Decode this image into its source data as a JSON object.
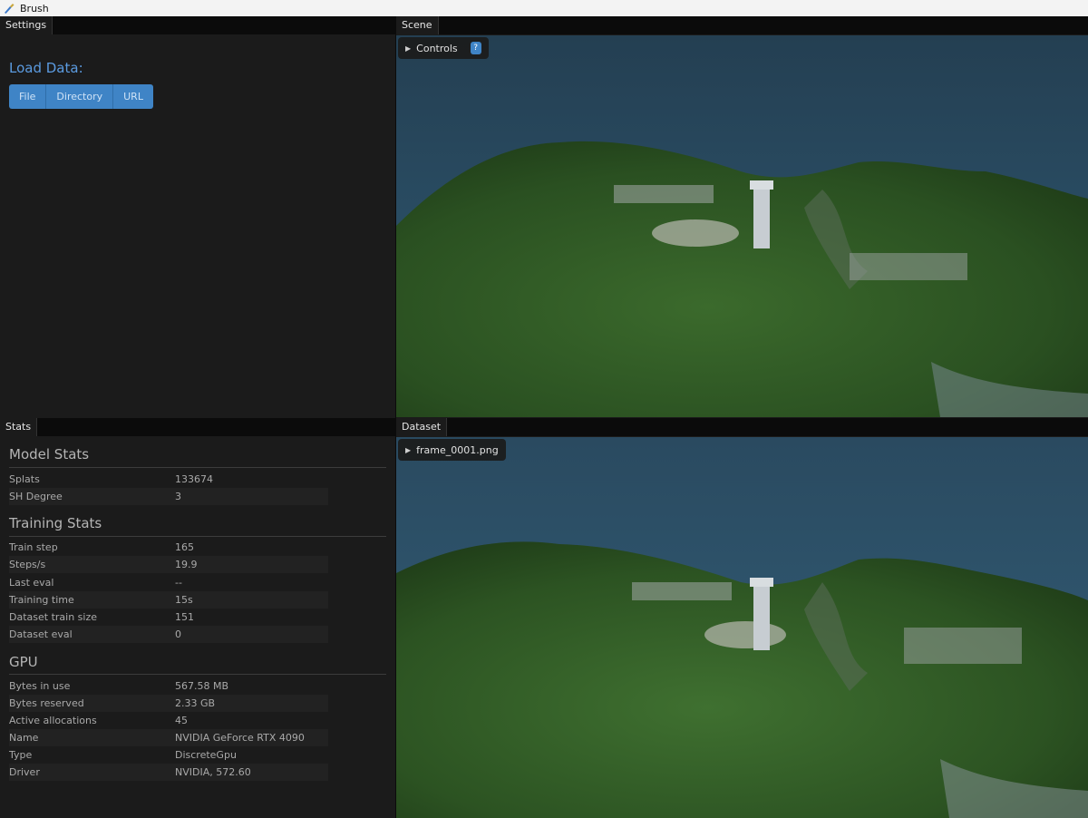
{
  "window": {
    "title": "Brush",
    "icon": "brush-icon"
  },
  "settings": {
    "tab": "Settings",
    "load_title": "Load Data:",
    "buttons": [
      "File",
      "Directory",
      "URL"
    ]
  },
  "scene": {
    "tab": "Scene",
    "controls_label": "Controls",
    "help_label": "?"
  },
  "dataset": {
    "tab": "Dataset",
    "frame_label": "frame_0001.png"
  },
  "stats": {
    "tab": "Stats",
    "model_title": "Model Stats",
    "model": [
      {
        "label": "Splats",
        "value": "133674"
      },
      {
        "label": "SH Degree",
        "value": "3"
      }
    ],
    "training_title": "Training Stats",
    "training": [
      {
        "label": "Train step",
        "value": "165"
      },
      {
        "label": "Steps/s",
        "value": "19.9"
      },
      {
        "label": "Last eval",
        "value": "--"
      },
      {
        "label": "Training time",
        "value": "15s"
      },
      {
        "label": "Dataset train size",
        "value": "151"
      },
      {
        "label": "Dataset eval",
        "value": "0"
      }
    ],
    "gpu_title": "GPU",
    "gpu": [
      {
        "label": "Bytes in use",
        "value": "567.58 MB"
      },
      {
        "label": "Bytes reserved",
        "value": "2.33 GB"
      },
      {
        "label": "Active allocations",
        "value": "45"
      },
      {
        "label": "Name",
        "value": "NVIDIA GeForce RTX 4090"
      },
      {
        "label": "Type",
        "value": "DiscreteGpu"
      },
      {
        "label": "Driver",
        "value": "NVIDIA, 572.60"
      }
    ]
  },
  "colors": {
    "accent": "#3f84c6",
    "title_blue": "#5b9be0",
    "panel_bg": "#1b1b1b",
    "sea": "#2e5570",
    "forest": "#2f5a26"
  }
}
